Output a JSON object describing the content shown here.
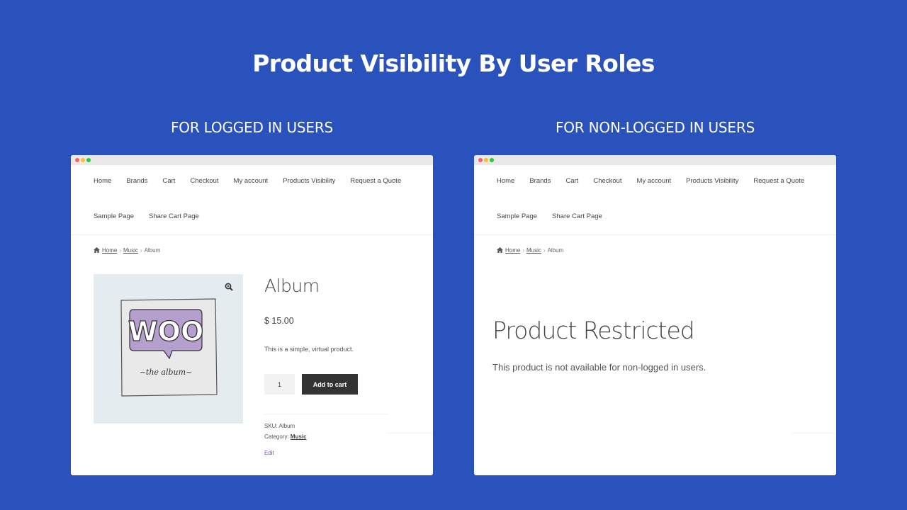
{
  "title": "Product Visibility By User Roles",
  "panels": {
    "left": {
      "heading": "FOR LOGGED IN USERS",
      "nav": [
        "Home",
        "Brands",
        "Cart",
        "Checkout",
        "My account",
        "Products Visibility",
        "Request a Quote",
        "Sample Page",
        "Share Cart Page"
      ],
      "breadcrumb": {
        "home": "Home",
        "sep1": "›",
        "music": "Music",
        "sep2": "›",
        "current": "Album"
      },
      "product": {
        "title": "Album",
        "price": "$ 15.00",
        "description": "This is a simple, virtual product.",
        "quantity": "1",
        "add_to_cart": "Add to cart",
        "sku": "SKU: Album",
        "category_label": "Category:",
        "category": "Music",
        "edit": "Edit",
        "art_logo": "WOO",
        "art_caption": "~the album~"
      }
    },
    "right": {
      "heading": "FOR NON-LOGGED IN USERS",
      "nav": [
        "Home",
        "Brands",
        "Cart",
        "Checkout",
        "My account",
        "Products Visibility",
        "Request a Quote",
        "Sample Page",
        "Share Cart Page"
      ],
      "breadcrumb": {
        "home": "Home",
        "sep1": "›",
        "music": "Music",
        "sep2": "›",
        "current": "Album"
      },
      "restricted_title": "Product Restricted",
      "restricted_message": "This product is not available for non-logged in users."
    }
  },
  "colors": {
    "background": "#2952bc",
    "button": "#333333",
    "edit_link": "#7a4bd1",
    "woo_purple": "#b59fcf"
  }
}
